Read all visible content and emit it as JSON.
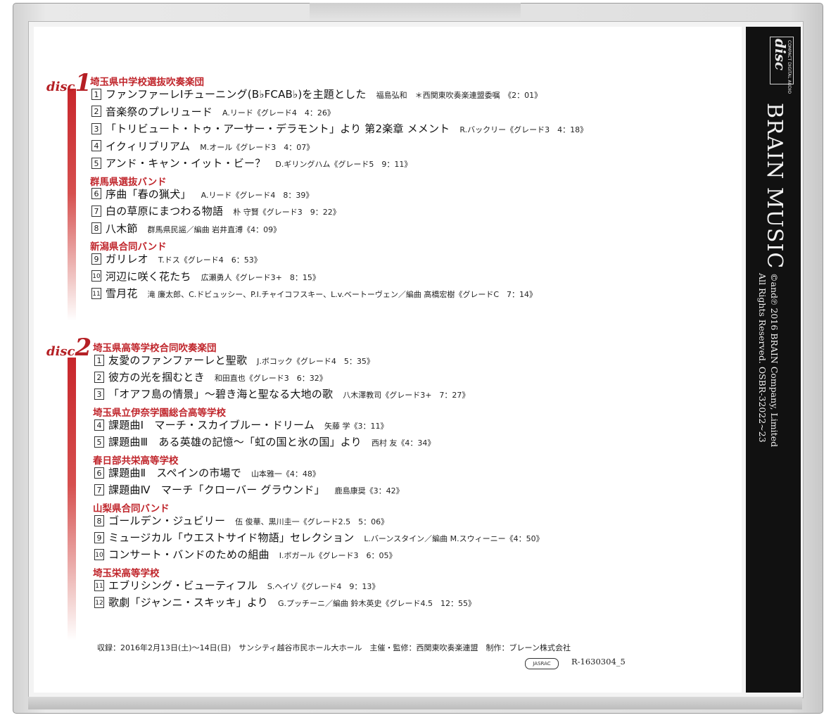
{
  "disc1": {
    "word": "disc",
    "number": "1",
    "groups": [
      {
        "title": "埼玉県中学校選抜吹奏楽団",
        "tracks": [
          {
            "num": "1",
            "title": "ファンファーレⅠチューニング(B♭FCAB♭)を主題とした",
            "info": "福島弘和　＊西関東吹奏楽連盟委嘱　《2：01》"
          },
          {
            "num": "2",
            "title": "音楽祭のプレリュード",
            "info": "A.リード《グレード4　4：26》"
          },
          {
            "num": "3",
            "title": "「トリビュート・トゥ・アーサー・デラモント」より 第2楽章 メメント",
            "info": "R.バックリー《グレード3　4：18》"
          },
          {
            "num": "4",
            "title": "イクィリブリアム",
            "info": "M.オール《グレード3　4：07》"
          },
          {
            "num": "5",
            "title": "アンド・キャン・イット・ビー？",
            "info": "D.ギリングハム《グレード5　9：11》"
          }
        ]
      },
      {
        "title": "群馬県選抜バンド",
        "tracks": [
          {
            "num": "6",
            "title": "序曲「春の猟犬」",
            "info": "A.リード《グレード4　8：39》"
          },
          {
            "num": "7",
            "title": "白の草原にまつわる物語",
            "info": "朴 守賢《グレード3　9：22》"
          },
          {
            "num": "8",
            "title": "八木節",
            "info": "群馬県民謡／編曲 岩井直溥《4：09》"
          }
        ]
      },
      {
        "title": "新潟県合同バンド",
        "tracks": [
          {
            "num": "9",
            "title": "ガリレオ",
            "info": "T.ドス《グレード4　6：53》"
          },
          {
            "num": "10",
            "title": "河辺に咲く花たち",
            "info": "広瀬勇人《グレード3+　8：15》"
          },
          {
            "num": "11",
            "title": "雪月花",
            "info": "滝 廉太郎、C.ドビュッシー、P.I.チャイコフスキー、L.v.ベートーヴェン／編曲 高橋宏樹《グレードC　7：14》"
          }
        ]
      }
    ]
  },
  "disc2": {
    "word": "disc",
    "number": "2",
    "groups": [
      {
        "title": "埼玉県高等学校合同吹奏楽団",
        "tracks": [
          {
            "num": "1",
            "title": "友愛のファンファーレと聖歌",
            "info": "J.ボコック《グレード4　5：35》"
          },
          {
            "num": "2",
            "title": "彼方の光を掴むとき",
            "info": "和田直也《グレード3　6：32》"
          },
          {
            "num": "3",
            "title": "「オアフ島の情景」～碧き海と聖なる大地の歌",
            "info": "八木澤教司《グレード3+　7：27》"
          }
        ]
      },
      {
        "title": "埼玉県立伊奈学園総合高等学校",
        "tracks": [
          {
            "num": "4",
            "title": "課題曲Ⅰ　マーチ・スカイブルー・ドリーム",
            "info": "矢藤 学《3：11》"
          },
          {
            "num": "5",
            "title": "課題曲Ⅲ　ある英雄の記憶～「虹の国と氷の国」より",
            "info": "西村 友《4：34》"
          }
        ]
      },
      {
        "title": "春日部共栄高等学校",
        "tracks": [
          {
            "num": "6",
            "title": "課題曲Ⅱ　スペインの市場で",
            "info": "山本雅一《4：48》"
          },
          {
            "num": "7",
            "title": "課題曲Ⅳ　マーチ「クローバー グラウンド」",
            "info": "鹿島康奨《3：42》"
          }
        ]
      },
      {
        "title": "山梨県合同バンド",
        "tracks": [
          {
            "num": "8",
            "title": "ゴールデン・ジュビリー",
            "info": "伍 俊華、黒川圭一《グレード2.5　5：06》"
          },
          {
            "num": "9",
            "title": "ミュージカル「ウエストサイド物語」セレクション",
            "info": "L.バーンスタイン／編曲 M.スウィーニー《4：50》"
          },
          {
            "num": "10",
            "title": "コンサート・バンドのための組曲",
            "info": "I.ボガール《グレード3　6：05》"
          }
        ]
      },
      {
        "title": "埼玉栄高等学校",
        "tracks": [
          {
            "num": "11",
            "title": "エブリシング・ビューティフル",
            "info": "S.ヘイゾ《グレード4　9：13》"
          },
          {
            "num": "12",
            "title": "歌劇「ジャンニ・スキッキ」より",
            "info": "G.プッチーニ／編曲 鈴木英史《グレード4.5　12：55》"
          }
        ]
      }
    ]
  },
  "footer": {
    "recording": "収録：2016年2月13日(土)～14日(日)　サンシティ越谷市民ホール大ホール　主催・監修：西関東吹奏楽連盟　制作：ブレーン株式会社",
    "jasrac": "JASRAC",
    "catalog": "R-1630304_5"
  },
  "spine": {
    "cd_logo": "disc",
    "cd_logo_sub": "COMPACT DIGITAL AUDIO",
    "brand": "BRAIN MUSIC",
    "copyright1": "©and℗ 2016 BRAIN Company, Limited",
    "copyright2": "All Rights Reserved. OSBR-32022~23"
  }
}
